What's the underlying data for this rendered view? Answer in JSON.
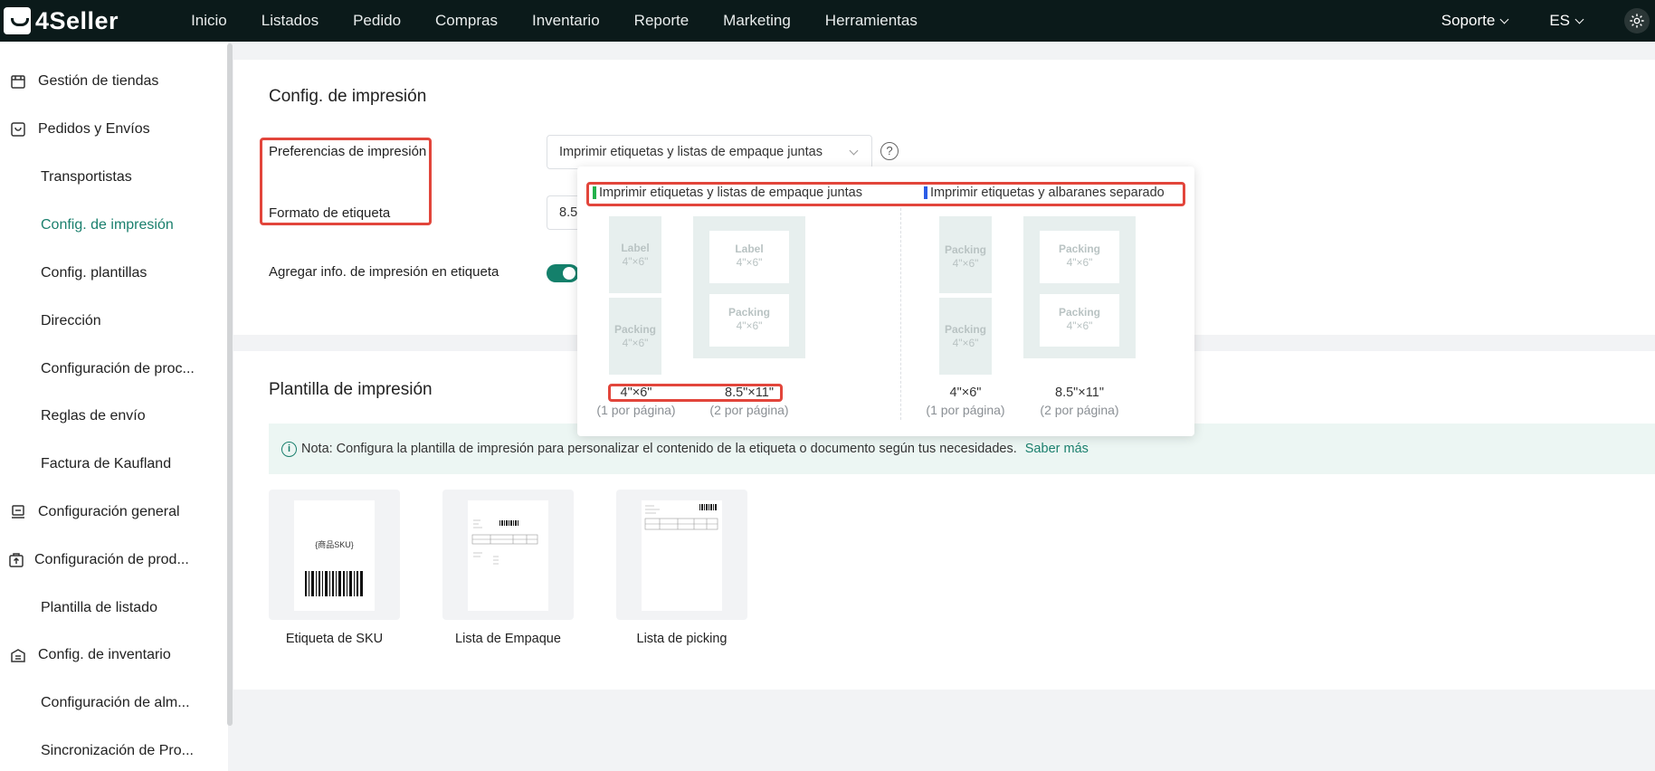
{
  "brand": {
    "name": "4Seller"
  },
  "nav": {
    "items": [
      "Inicio",
      "Listados",
      "Pedido",
      "Compras",
      "Inventario",
      "Reporte",
      "Marketing",
      "Herramientas"
    ]
  },
  "topright": {
    "support": "Soporte",
    "lang": "ES"
  },
  "sidebar": {
    "items": [
      {
        "label": "Gestión de tiendas",
        "icon": "store-icon"
      },
      {
        "label": "Pedidos y Envíos",
        "icon": "order-bag-icon"
      },
      {
        "label": "Transportistas"
      },
      {
        "label": "Config. de impresión",
        "active": true
      },
      {
        "label": "Config. plantillas"
      },
      {
        "label": "Dirección"
      },
      {
        "label": "Configuración de proc..."
      },
      {
        "label": "Reglas de envío"
      },
      {
        "label": "Factura de Kaufland"
      },
      {
        "label": "Configuración general",
        "icon": "monitor-settings-icon"
      },
      {
        "label": "Configuración de prod...",
        "icon": "product-upload-icon"
      },
      {
        "label": "Plantilla de listado"
      },
      {
        "label": "Config. de inventario",
        "icon": "inventory-icon"
      },
      {
        "label": "Configuración de alm..."
      },
      {
        "label": "Sincronización de Pro..."
      }
    ]
  },
  "print_config": {
    "title": "Config. de impresión",
    "pref_label": "Preferencias de impresión",
    "pref_value": "Imprimir etiquetas y listas de empaque juntas",
    "format_label": "Formato de etiqueta",
    "format_value": "8.5",
    "add_info_label": "Agregar info. de impresión en etiqueta",
    "add_info_enabled": true
  },
  "popup": {
    "option_together": "Imprimir etiquetas y listas de empaque juntas",
    "option_separate": "Imprimir etiquetas y albaranes separado",
    "together_color": "#22b14c",
    "separate_color": "#2b5ce6",
    "word_label": "Label",
    "word_packing": "Packing",
    "dim_4x6": "4\"×6\"",
    "size_4x6": "4\"×6\"",
    "size_85x11": "8.5\"×11\"",
    "per_page_1": "(1 por página)",
    "per_page_2": "(2 por página)"
  },
  "template_section": {
    "title": "Plantilla de impresión",
    "note": "Nota: Configura la plantilla de impresión para personalizar el contenido de la etiqueta o documento según tus necesidades.",
    "learn_more": "Saber más",
    "sku_placeholder": "{商品SKU}",
    "templates": [
      "Etiqueta de SKU",
      "Lista de Empaque",
      "Lista de picking"
    ]
  },
  "colors": {
    "accent": "#1a7f6d",
    "highlight": "#e2453b",
    "topbar": "#0b1a1a"
  }
}
